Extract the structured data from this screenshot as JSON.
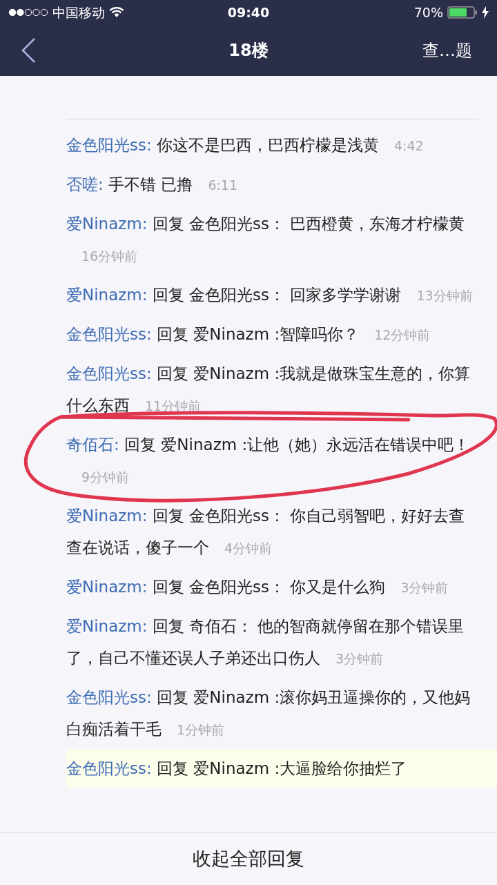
{
  "status_bar": {
    "carrier": "中国移动",
    "time": "09:40",
    "battery": "70%"
  },
  "nav": {
    "title": "18楼",
    "action": "查…题"
  },
  "replies": [
    {
      "author": "金色阳光ss:",
      "text": "你这不是巴西，巴西柠檬是浅黄",
      "time": "4:42",
      "highlighted": false,
      "circled": false
    },
    {
      "author": "否嗟:",
      "text": "手不错 已撸",
      "time": "6:11",
      "highlighted": false,
      "circled": false
    },
    {
      "author": "爱Ninazm:",
      "text": "回复 金色阳光ss： 巴西橙黄，东海才柠檬黄",
      "time": "16分钟前",
      "highlighted": false,
      "circled": false
    },
    {
      "author": "爱Ninazm:",
      "text": "回复 金色阳光ss： 回家多学学谢谢",
      "time": "13分钟前",
      "highlighted": false,
      "circled": false
    },
    {
      "author": "金色阳光ss:",
      "text": "回复 爱Ninazm :智障吗你？",
      "time": "12分钟前",
      "highlighted": false,
      "circled": false
    },
    {
      "author": "金色阳光ss:",
      "text": "回复 爱Ninazm :我就是做珠宝生意的，你算什么东西",
      "time": "11分钟前",
      "highlighted": false,
      "circled": false
    },
    {
      "author": "奇佰石:",
      "text": "回复 爱Ninazm :让他（她）永远活在错误中吧！",
      "time": "9分钟前",
      "highlighted": false,
      "circled": true
    },
    {
      "author": "爱Ninazm:",
      "text": "回复 金色阳光ss： 你自己弱智吧，好好去查查在说话，傻子一个",
      "time": "4分钟前",
      "highlighted": false,
      "circled": false
    },
    {
      "author": "爱Ninazm:",
      "text": "回复 金色阳光ss： 你又是什么狗",
      "time": "3分钟前",
      "highlighted": false,
      "circled": false
    },
    {
      "author": "爱Ninazm:",
      "text": "回复 奇佰石： 他的智商就停留在那个错误里了，自己不懂还误人子弟还出口伤人",
      "time": "3分钟前",
      "highlighted": false,
      "circled": false
    },
    {
      "author": "金色阳光ss:",
      "text": "回复 爱Ninazm :滚你妈丑逼操你的，又他妈白痴活着干毛",
      "time": "1分钟前",
      "highlighted": false,
      "circled": false
    },
    {
      "author": "金色阳光ss:",
      "text": "回复 爱Ninazm :大逼脸给你抽烂了",
      "highlighted": true,
      "circled": false
    }
  ],
  "footer_button": "收起全部回复"
}
